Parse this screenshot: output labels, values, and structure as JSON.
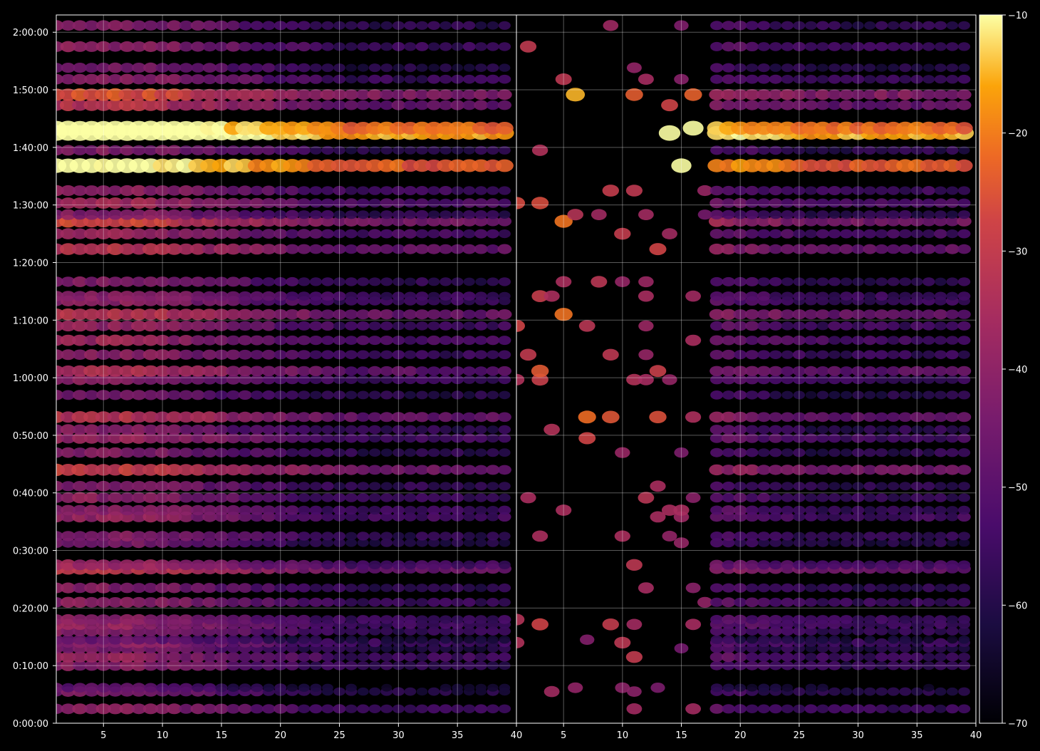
{
  "chart_data": {
    "type": "heatmap",
    "panels": 2,
    "x_range": [
      1,
      40
    ],
    "x_ticks": [
      5,
      10,
      15,
      20,
      25,
      30,
      35,
      40
    ],
    "y_range_seconds": [
      0,
      7380
    ],
    "y_ticks": [
      "0:00:00",
      "0:10:00",
      "0:20:00",
      "0:30:00",
      "0:40:00",
      "0:50:00",
      "1:00:00",
      "1:10:00",
      "1:20:00",
      "1:30:00",
      "1:40:00",
      "1:50:00",
      "2:00:00"
    ],
    "y_tick_seconds": [
      0,
      600,
      1200,
      1800,
      2400,
      3000,
      3600,
      4200,
      4800,
      5400,
      6000,
      6600,
      7200
    ],
    "grid": true,
    "colormap": "inferno",
    "colorbar": {
      "min": -70,
      "max": -10,
      "ticks": [
        "−10",
        "−20",
        "−30",
        "−40",
        "−50",
        "−60",
        "−70"
      ],
      "tick_values": [
        -10,
        -20,
        -30,
        -40,
        -50,
        -60,
        -70
      ]
    },
    "bands": [
      {
        "t": 150,
        "level": -56
      },
      {
        "t": 330,
        "level": -60
      },
      {
        "t": 370,
        "level": -66
      },
      {
        "t": 600,
        "level": -57
      },
      {
        "t": 690,
        "level": -55
      },
      {
        "t": 780,
        "level": -60
      },
      {
        "t": 840,
        "level": -56
      },
      {
        "t": 870,
        "level": -64
      },
      {
        "t": 960,
        "level": -57
      },
      {
        "t": 1030,
        "level": -55
      },
      {
        "t": 1080,
        "level": -56
      },
      {
        "t": 1260,
        "level": -56
      },
      {
        "t": 1410,
        "level": -58
      },
      {
        "t": 1610,
        "level": -47
      },
      {
        "t": 1650,
        "level": -54
      },
      {
        "t": 1880,
        "level": -60
      },
      {
        "t": 1950,
        "level": -58
      },
      {
        "t": 2150,
        "level": -54
      },
      {
        "t": 2220,
        "level": -56
      },
      {
        "t": 2350,
        "level": -56
      },
      {
        "t": 2470,
        "level": -58
      },
      {
        "t": 2640,
        "level": -45
      },
      {
        "t": 2820,
        "level": -58
      },
      {
        "t": 2970,
        "level": -54
      },
      {
        "t": 3060,
        "level": -58
      },
      {
        "t": 3190,
        "level": -48
      },
      {
        "t": 3420,
        "level": -60
      },
      {
        "t": 3580,
        "level": -56
      },
      {
        "t": 3670,
        "level": -49
      },
      {
        "t": 3840,
        "level": -56
      },
      {
        "t": 3990,
        "level": -53
      },
      {
        "t": 4140,
        "level": -55
      },
      {
        "t": 4260,
        "level": -47
      },
      {
        "t": 4400,
        "level": -56
      },
      {
        "t": 4450,
        "level": -56
      },
      {
        "t": 4600,
        "level": -58
      },
      {
        "t": 4940,
        "level": -48
      },
      {
        "t": 5100,
        "level": -54
      },
      {
        "t": 5230,
        "level": -44
      },
      {
        "t": 5300,
        "level": -58
      },
      {
        "t": 5420,
        "level": -52
      },
      {
        "t": 5550,
        "level": -55
      },
      {
        "t": 5810,
        "level": -24
      },
      {
        "t": 5970,
        "level": -58
      },
      {
        "t": 6150,
        "level": -16
      },
      {
        "t": 6200,
        "level": -22
      },
      {
        "t": 6440,
        "level": -48
      },
      {
        "t": 6550,
        "level": -42
      },
      {
        "t": 6710,
        "level": -56
      },
      {
        "t": 6830,
        "level": -60
      },
      {
        "t": 7050,
        "level": -56
      },
      {
        "t": 7270,
        "level": -58
      }
    ]
  }
}
